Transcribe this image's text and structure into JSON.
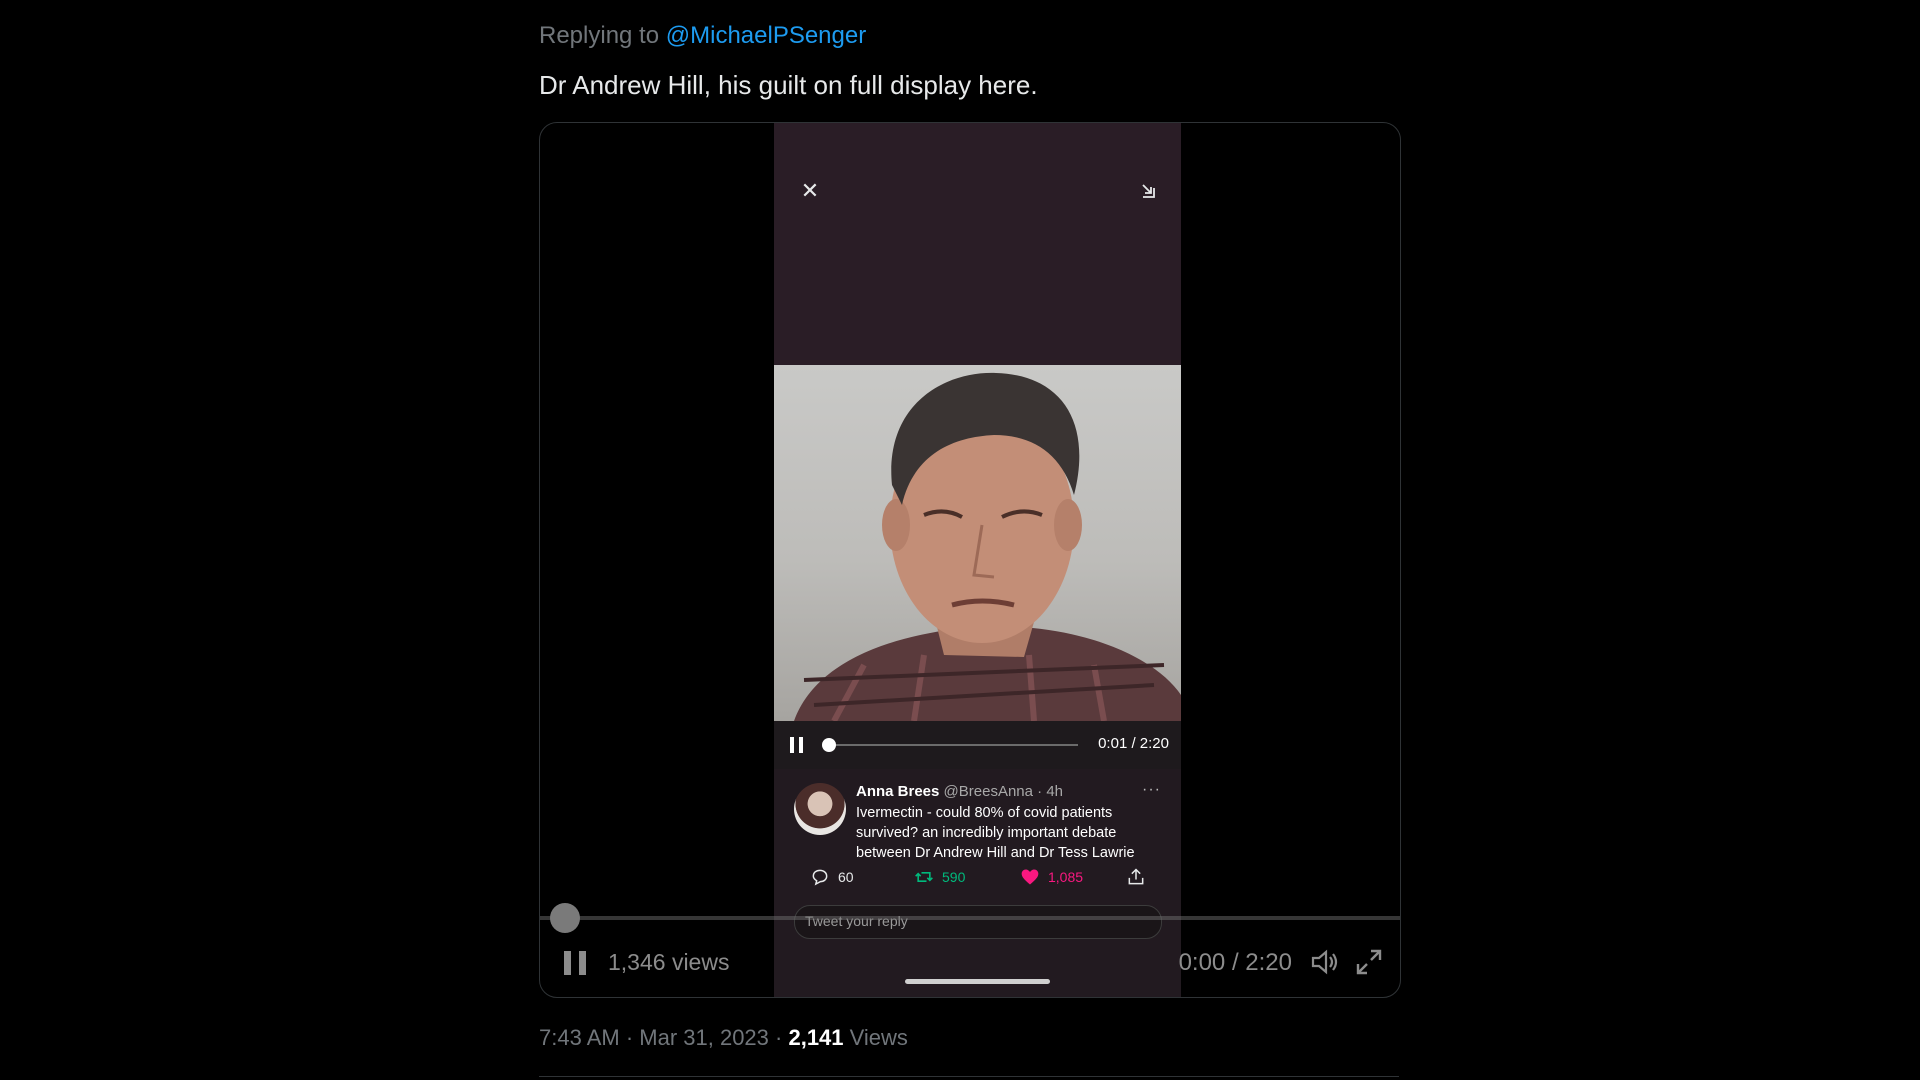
{
  "reply": {
    "prefix": "Replying to ",
    "mention": "@MichaelPSenger"
  },
  "tweet": {
    "text": "Dr Andrew Hill, his guilt on full display here.",
    "timestamp": "7:43 AM · Mar 31, 2023 · ",
    "views_count": "2,141",
    "views_label": " Views"
  },
  "player": {
    "views": "1,346 views",
    "time": "0:00 / 2:20",
    "progress": 0.0
  },
  "inner_video": {
    "close_glyph": "✕",
    "time": "0:01 / 2:20",
    "progress": 0.007
  },
  "embedded_tweet": {
    "name": "Anna Brees",
    "handle": "@BreesAnna",
    "age": "· 4h",
    "more": "···",
    "body": "Ivermectin - could 80% of covid patients survived? an incredibly important debate between Dr Andrew Hill and Dr Tess Lawrie",
    "replies": "60",
    "retweets": "590",
    "likes": "1,085",
    "reply_placeholder": "Tweet your reply"
  },
  "colors": {
    "link": "#1d9bf0",
    "retweet": "#00ba7c",
    "like": "#f91880"
  },
  "icons": [
    "close-icon",
    "minimize-icon",
    "pause-icon",
    "reply-icon",
    "retweet-icon",
    "like-icon",
    "share-icon",
    "volume-icon",
    "fullscreen-icon"
  ]
}
